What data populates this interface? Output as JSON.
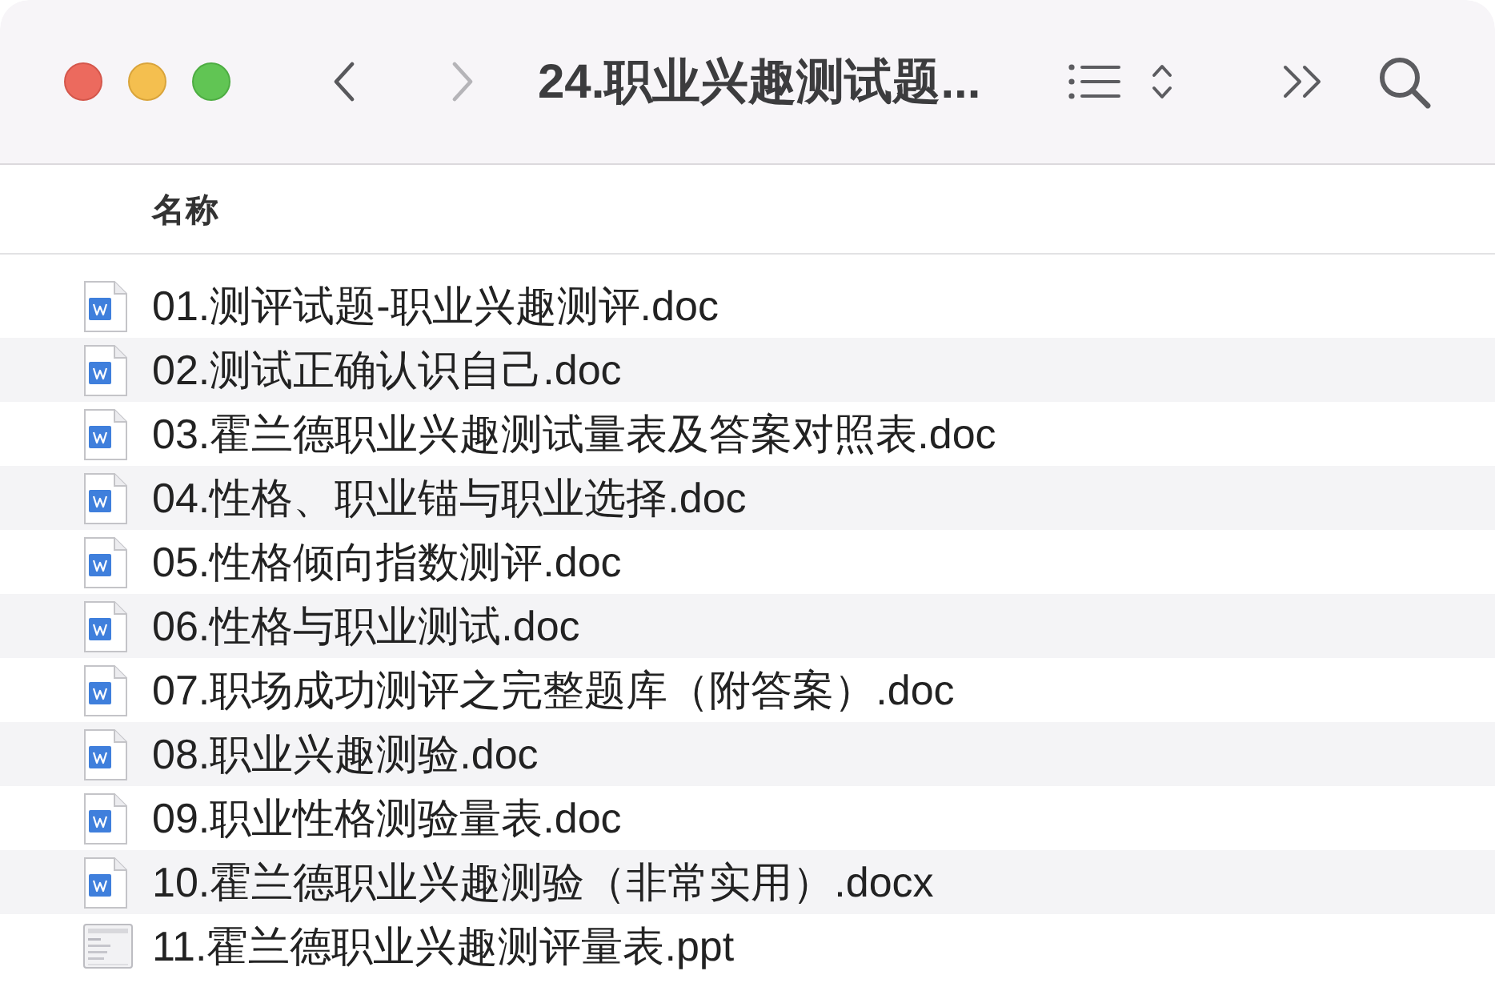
{
  "window": {
    "title": "24.职业兴趣测试题..."
  },
  "toolbar": {
    "nav": [
      {
        "kind": "back",
        "disabled": false
      },
      {
        "kind": "forward",
        "disabled": true
      }
    ]
  },
  "list": {
    "column_header": "名称",
    "files": [
      {
        "name": "01.测评试题-职业兴趣测评.doc",
        "kind": "word"
      },
      {
        "name": "02.测试正确认识自己.doc",
        "kind": "word"
      },
      {
        "name": "03.霍兰德职业兴趣测试量表及答案对照表.doc",
        "kind": "word"
      },
      {
        "name": "04.性格、职业锚与职业选择.doc",
        "kind": "word"
      },
      {
        "name": "05.性格倾向指数测评.doc",
        "kind": "word"
      },
      {
        "name": "06.性格与职业测试.doc",
        "kind": "word"
      },
      {
        "name": "07.职场成功测评之完整题库（附答案）.doc",
        "kind": "word"
      },
      {
        "name": "08.职业兴趣测验.doc",
        "kind": "word"
      },
      {
        "name": "09.职业性格测验量表.doc",
        "kind": "word"
      },
      {
        "name": "10.霍兰德职业兴趣测验（非常实用）.docx",
        "kind": "word"
      },
      {
        "name": "11.霍兰德职业兴趣测评量表.ppt",
        "kind": "presentation"
      }
    ]
  }
}
